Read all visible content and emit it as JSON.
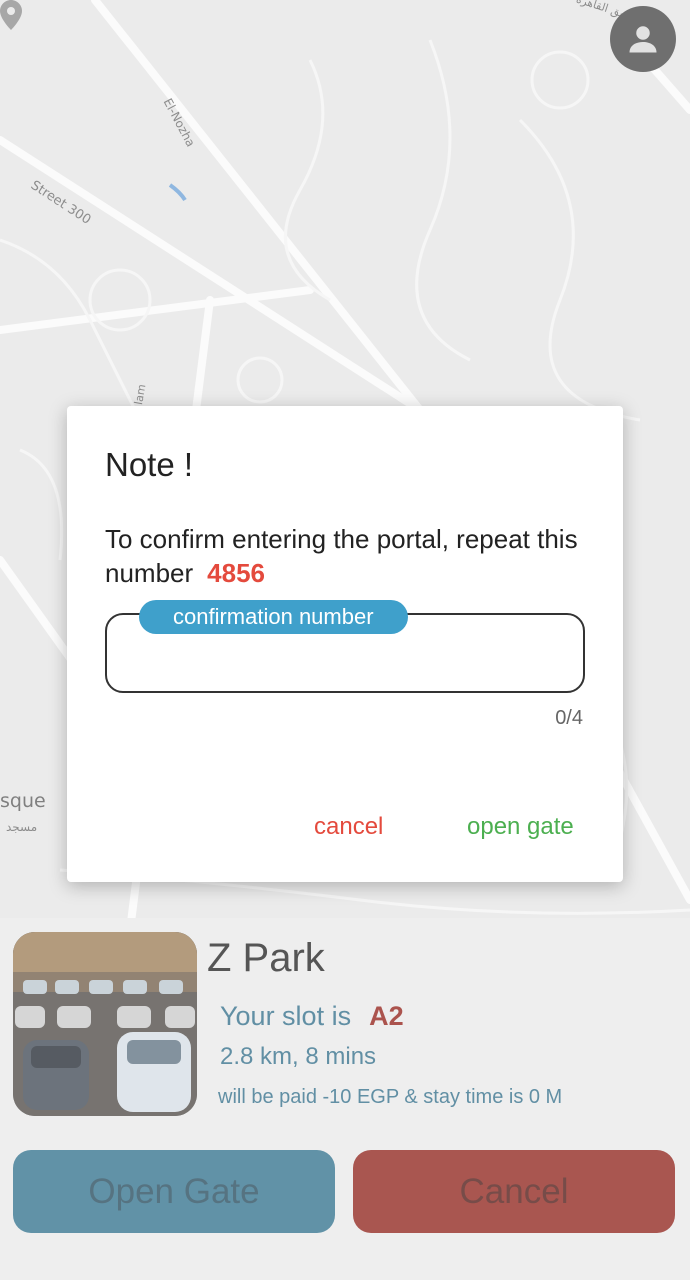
{
  "map": {
    "street_labels": {
      "street_300": "Street 300",
      "el_nozha": "El-Nozha",
      "arabic_road": "طريق القاهرة",
      "partial": "lam"
    },
    "poi": {
      "name_en": "sque",
      "name_ar": "مسجد"
    }
  },
  "header": {
    "profile_icon": "account-circle-icon"
  },
  "dialog": {
    "title": "Note !",
    "message": "To confirm entering the portal, repeat this number",
    "code": "4856",
    "input": {
      "label": "confirmation number",
      "value": "",
      "counter": "0/4"
    },
    "actions": {
      "cancel": "cancel",
      "confirm": "open gate"
    }
  },
  "parking": {
    "name": "Z Park",
    "slot_prefix": "Your slot is",
    "slot": "A2",
    "distance": "2.8 km, 8 mins",
    "payment_info": "will be paid -10 EGP & stay time is 0 M",
    "buttons": {
      "open_gate": "Open Gate",
      "cancel": "Cancel"
    }
  },
  "colors": {
    "accent_blue": "#3fa0cb",
    "danger_red": "#e44a3d",
    "success_green": "#4caf50",
    "primary_button": "#2c6e8a",
    "cancel_button": "#8c1e16"
  }
}
